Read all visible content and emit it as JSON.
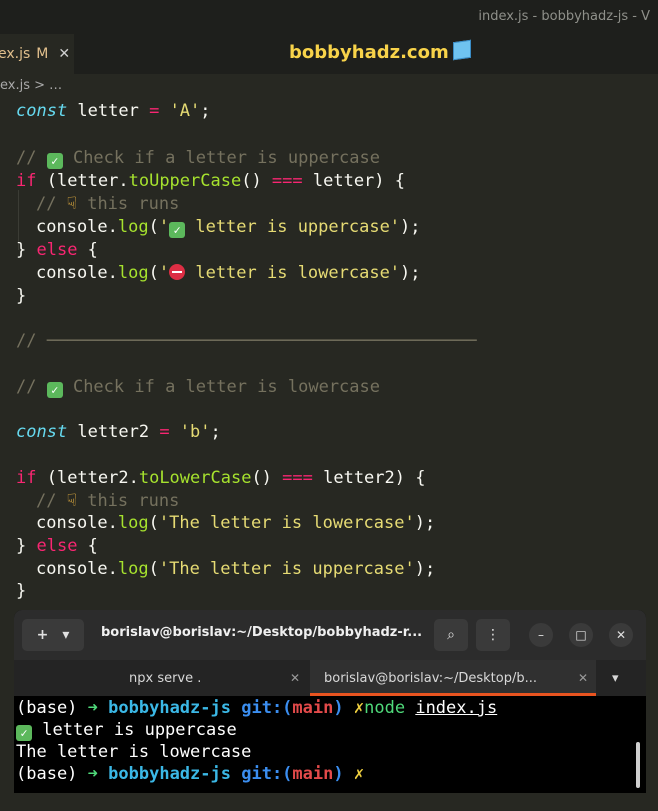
{
  "window": {
    "title": "index.js - bobbyhadz-js - V"
  },
  "tab": {
    "label": "ex.js",
    "modified": "M",
    "close": "✕"
  },
  "site": {
    "label": "bobbyhadz.com"
  },
  "breadcrumb": {
    "text": "ex.js > …"
  },
  "code": {
    "l1": {
      "kw": "const",
      "rest": " letter ",
      "op": "=",
      "str": " 'A'",
      "end": ";"
    },
    "l2": {
      "c1": "// ",
      "c2": " Check if a letter is uppercase"
    },
    "l3": {
      "kw": "if",
      "p1": " (letter.",
      "fn": "toUpperCase",
      "p2": "() ",
      "op": "===",
      "p3": " letter) {"
    },
    "l4": {
      "c1": "// ",
      "c2": " this runs"
    },
    "l5": {
      "a": "console.",
      "fn": "log",
      "b": "(",
      "s1": "'",
      "s2": " letter is uppercase'",
      "c": ");"
    },
    "l6": {
      "a": "} ",
      "kw": "else",
      "b": " {"
    },
    "l7": {
      "a": "console.",
      "fn": "log",
      "b": "(",
      "s1": "'",
      "s2": " letter is lowercase'",
      "c": ");"
    },
    "l8": "}",
    "l9": "// ──────────────────────────────────────────",
    "l10": {
      "c1": "// ",
      "c2": " Check if a letter is lowercase"
    },
    "l11": {
      "kw": "const",
      "rest": " letter2 ",
      "op": "=",
      "str": " 'b'",
      "end": ";"
    },
    "l12": {
      "kw": "if",
      "p1": " (letter2.",
      "fn": "toLowerCase",
      "p2": "() ",
      "op": "===",
      "p3": " letter2) {"
    },
    "l13": {
      "c1": "// ",
      "c2": " this runs"
    },
    "l14": {
      "a": "console.",
      "fn": "log",
      "b": "(",
      "s": "'The letter is lowercase'",
      "c": ");"
    },
    "l15": {
      "a": "} ",
      "kw": "else",
      "b": " {"
    },
    "l16": {
      "a": "console.",
      "fn": "log",
      "b": "(",
      "s": "'The letter is uppercase'",
      "c": ");"
    },
    "l17": "}"
  },
  "terminal": {
    "title": "borislav@borislav:~/Desktop/bobbyhadz-r...",
    "new_tab": "+",
    "dropdown": "▾",
    "search": "⌕",
    "menu": "⋮",
    "minimize": "–",
    "maximize": "□",
    "close": "✕",
    "tabs": [
      {
        "label": "npx serve .",
        "close": "✕"
      },
      {
        "label": "borislav@borislav:~/Desktop/b...",
        "close": "✕"
      }
    ],
    "tabs_dropdown": "▾",
    "lines": {
      "p1_base": "(base) ",
      "arrow": "➜",
      "project": "bobbyhadz-js",
      "git": "git:(",
      "branch": "main",
      "git_close": ")",
      "x": "✗",
      "cmd": "node",
      "file": "index.js",
      "out1": " letter is uppercase",
      "out2": "The letter is lowercase"
    }
  },
  "colors": {
    "accent": "#e95420",
    "editor_bg": "#272822",
    "terminal_bg": "#000000"
  }
}
